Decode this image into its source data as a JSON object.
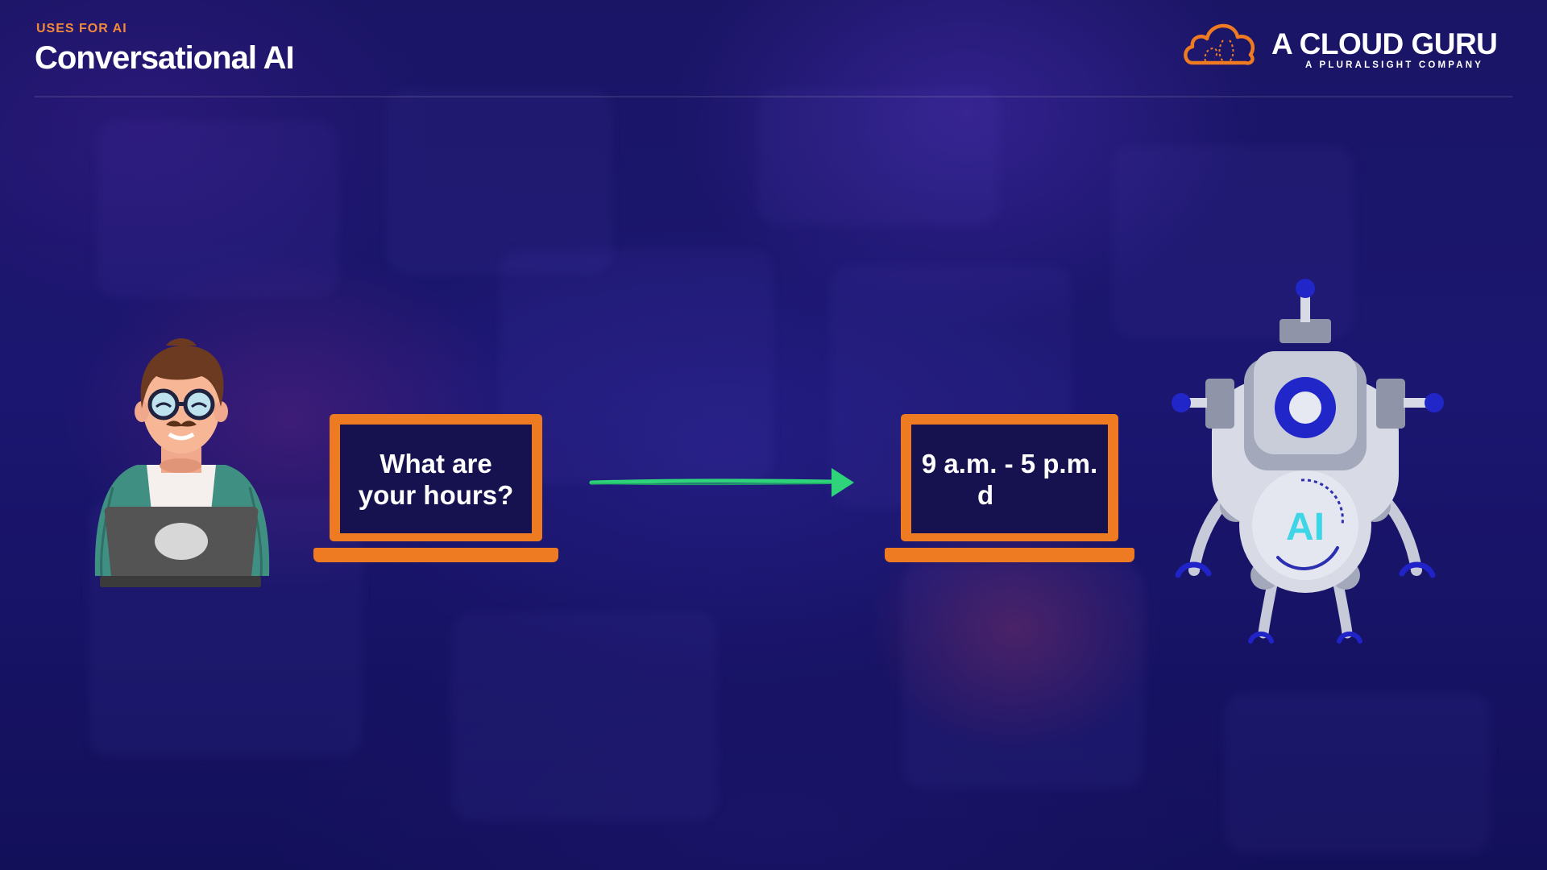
{
  "header": {
    "eyebrow": "USES FOR AI",
    "title": "Conversational AI"
  },
  "brand": {
    "name": "A CLOUD GURU",
    "tagline": "A PLURALSIGHT COMPANY",
    "icon": "cloud-icon"
  },
  "diagram": {
    "user_message": {
      "line1": "What are",
      "line2": "your hours?"
    },
    "ai_reply": {
      "line1": "9 a.m. - 5 p.m.",
      "line2": "d"
    },
    "robot_label": "AI",
    "arrow_icon": "arrow-right-icon",
    "user_icon": "person-with-laptop-icon",
    "robot_icon": "robot-icon"
  },
  "colors": {
    "accent_orange": "#ee7a22",
    "arrow_green": "#2fd37a",
    "background": "#1a1565",
    "robot_body": "#d8dbe6",
    "robot_blue": "#1f23c8"
  }
}
